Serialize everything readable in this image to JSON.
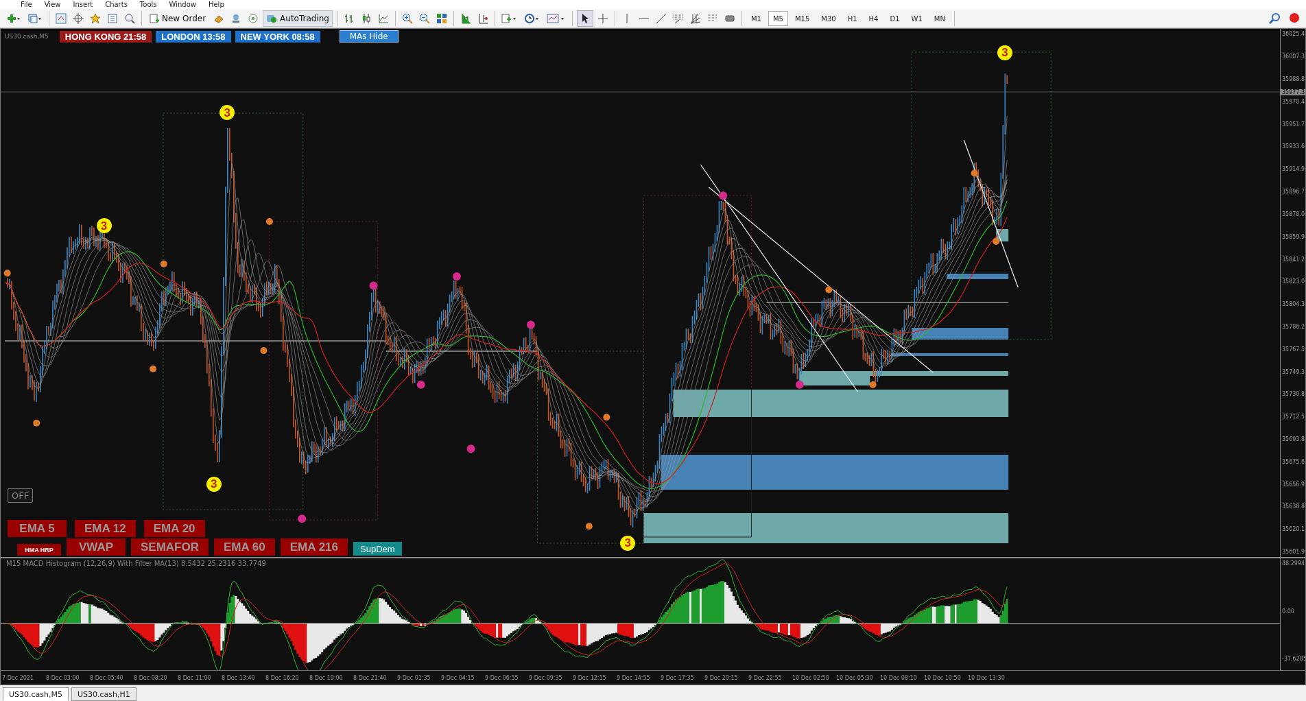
{
  "menu_bar": [
    "File",
    "View",
    "Insert",
    "Charts",
    "Tools",
    "Window",
    "Help"
  ],
  "toolbar": {
    "new_order": "New Order",
    "auto_trading": {
      "label": "AutoTrading",
      "on": true
    },
    "timeframes": [
      {
        "label": "M1",
        "selected": false
      },
      {
        "label": "M5",
        "selected": true
      },
      {
        "label": "M15",
        "selected": false
      },
      {
        "label": "M30",
        "selected": false
      },
      {
        "label": "H1",
        "selected": false
      },
      {
        "label": "H4",
        "selected": false
      },
      {
        "label": "D1",
        "selected": false
      },
      {
        "label": "W1",
        "selected": false
      },
      {
        "label": "MN",
        "selected": false
      }
    ]
  },
  "chart": {
    "symbol": "US30.cash,M5",
    "sessions": [
      {
        "label": "HONG KONG 21:58",
        "color": "#9b1b1b"
      },
      {
        "label": "LONDON  13:58",
        "color": "#1e72c8"
      },
      {
        "label": "NEW YORK 08:58",
        "color": "#1e72c8"
      }
    ],
    "ma_toggle": "MAs Hide",
    "off_button": "OFF",
    "indicator_buttons": [
      [
        {
          "label": "EMA 5",
          "kind": "large"
        },
        {
          "label": "EMA 12",
          "kind": "large"
        },
        {
          "label": "EMA 20",
          "kind": "large"
        }
      ],
      [
        {
          "label": "HMA HRP",
          "kind": "small"
        },
        {
          "label": "VWAP",
          "kind": "large"
        },
        {
          "label": "SEMAFOR",
          "kind": "large"
        },
        {
          "label": "EMA 60",
          "kind": "large"
        },
        {
          "label": "EMA 216",
          "kind": "large"
        },
        {
          "label": "SupDem",
          "kind": "teal"
        }
      ]
    ],
    "semafor_peaks": [
      "3",
      "3",
      "3",
      "3",
      "3"
    ],
    "price_axis": [
      "36025.4",
      "36007.3",
      "35988.8",
      "35970.4",
      "35951.7",
      "35933.6",
      "35914.9",
      "35896.7",
      "35878.0",
      "35859.9",
      "35841.2",
      "35823.0",
      "35804.3",
      "35786.2",
      "35767.5",
      "35749.3",
      "35730.8",
      "35712.5",
      "35693.8",
      "35675.6",
      "35656.9",
      "35638.8",
      "35620.1",
      "35601.9"
    ],
    "current_price": "35977.3"
  },
  "macd": {
    "title": "M15 MACD Histogram (12,26,9) With Filter MA(13) 8.5432 25.2316 33.7749",
    "axis": [
      "48.2994",
      "0.00",
      "-37.6285"
    ]
  },
  "time_axis": [
    "7 Dec 2021",
    "8 Dec 03:00",
    "8 Dec 05:40",
    "8 Dec 08:20",
    "8 Dec 11:00",
    "8 Dec 13:40",
    "8 Dec 16:20",
    "8 Dec 19:00",
    "8 Dec 21:40",
    "9 Dec 01:35",
    "9 Dec 04:15",
    "9 Dec 06:55",
    "9 Dec 09:35",
    "9 Dec 12:15",
    "9 Dec 14:55",
    "9 Dec 17:35",
    "9 Dec 20:15",
    "9 Dec 22:55",
    "10 Dec 02:50",
    "10 Dec 05:30",
    "10 Dec 08:10",
    "10 Dec 10:50",
    "10 Dec 13:30"
  ],
  "tabs": [
    {
      "label": "US30.cash,M5",
      "selected": true
    },
    {
      "label": "US30.cash,H1",
      "selected": false
    }
  ]
}
